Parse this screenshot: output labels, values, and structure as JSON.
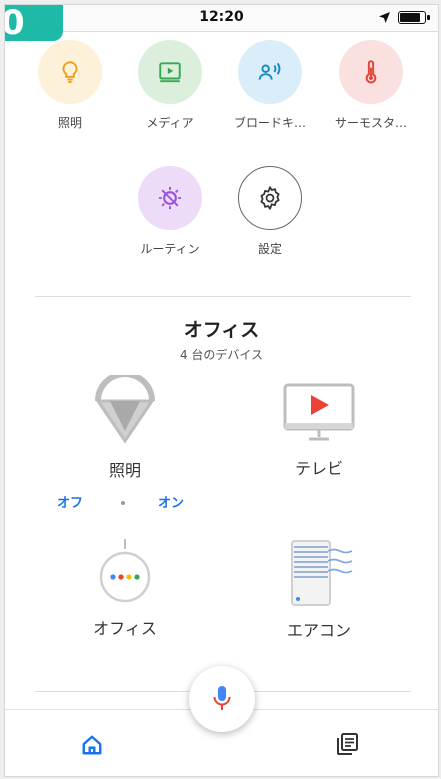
{
  "badge": {
    "text": "0"
  },
  "status_bar": {
    "time": "12:20"
  },
  "shortcuts": [
    {
      "label": "照明",
      "icon": "lightbulb-icon",
      "bg": "#fdf1d9",
      "color": "#f0a020"
    },
    {
      "label": "メディア",
      "icon": "media-play-icon",
      "bg": "#dcefdc",
      "color": "#34a853"
    },
    {
      "label": "ブロードキ…",
      "icon": "broadcast-icon",
      "bg": "#d9eef8",
      "color": "#1a8bc4"
    },
    {
      "label": "サーモスタ…",
      "icon": "thermostat-icon",
      "bg": "#fbe0e0",
      "color": "#e0453a"
    },
    {
      "label": "ルーティン",
      "icon": "routine-icon",
      "bg": "#ecdcf8",
      "color": "#9b51e0"
    },
    {
      "label": "設定",
      "icon": "gear-icon",
      "bg": "#ffffff",
      "color": "#333333"
    }
  ],
  "room": {
    "title": "オフィス",
    "device_count": "4 台のデバイス"
  },
  "devices": [
    {
      "label": "照明",
      "icon": "ceiling-lamp-icon"
    },
    {
      "label": "テレビ",
      "icon": "tv-icon"
    },
    {
      "label": "オフィス",
      "icon": "google-home-mini-icon"
    },
    {
      "label": "エアコン",
      "icon": "air-conditioner-icon"
    }
  ],
  "light_controls": {
    "off": "オフ",
    "on": "オン"
  },
  "colors": {
    "accent": "#1a73e8"
  },
  "nav": {
    "home": "home-icon",
    "feed": "feed-icon"
  }
}
